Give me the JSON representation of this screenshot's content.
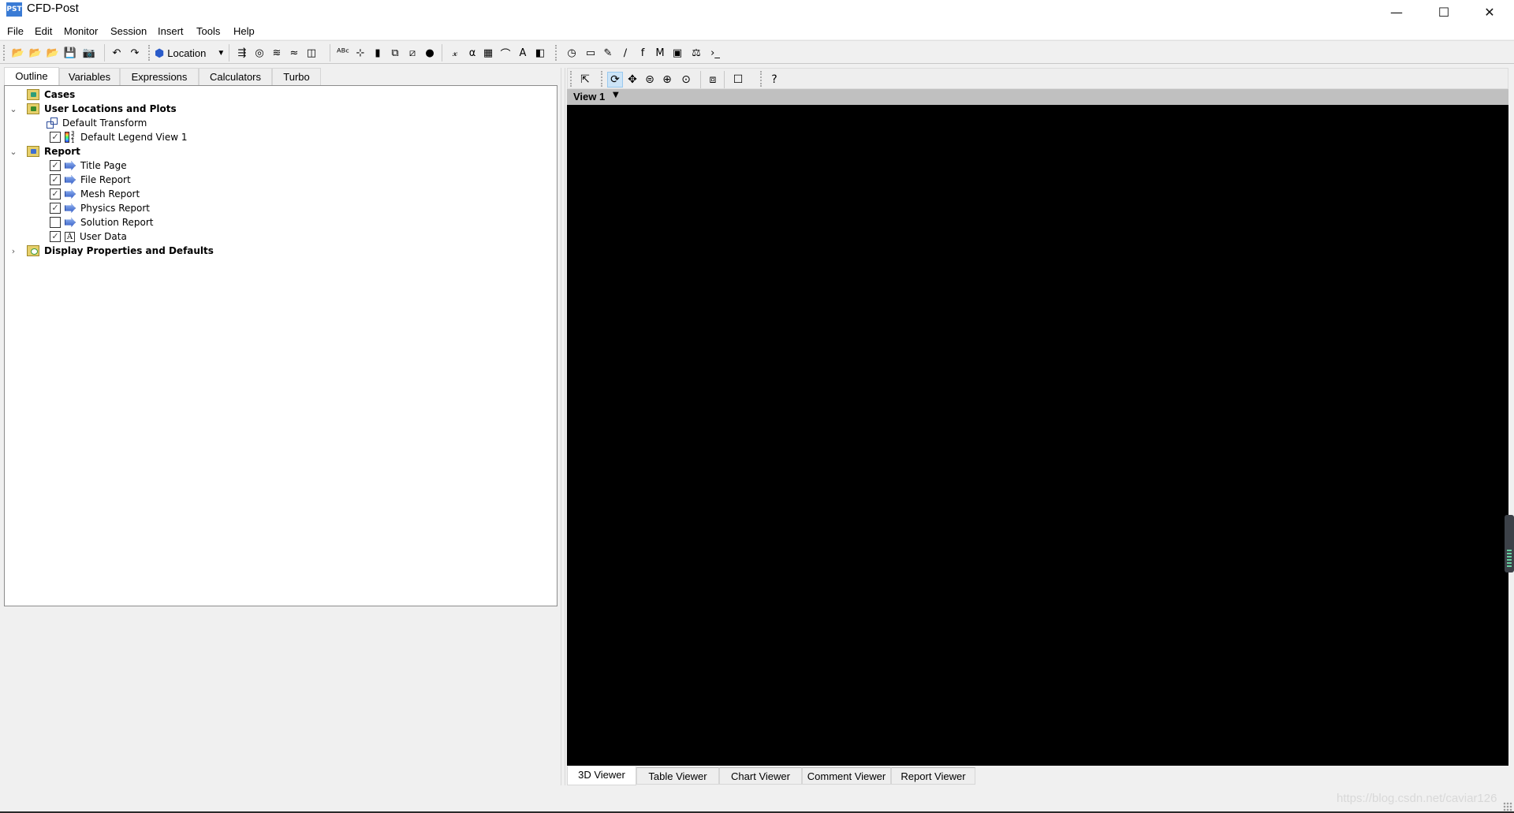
{
  "window": {
    "app_icon_text": "PST",
    "title": "CFD-Post",
    "minimize_glyph": "—",
    "maximize_glyph": "☐",
    "close_glyph": "✕"
  },
  "menubar": {
    "items": [
      "File",
      "Edit",
      "Monitor",
      "Session",
      "Insert",
      "Tools",
      "Help"
    ]
  },
  "toolbar": {
    "location_label": "Location",
    "icons": [
      {
        "name": "load-state-icon",
        "glyph": "📂"
      },
      {
        "name": "load-results-icon",
        "glyph": "📂"
      },
      {
        "name": "close-state-icon",
        "glyph": "📂"
      },
      {
        "name": "save-state-icon",
        "glyph": "💾"
      },
      {
        "name": "save-picture-icon",
        "glyph": "📷"
      },
      {
        "name": "undo-icon",
        "glyph": "↶"
      },
      {
        "name": "redo-icon",
        "glyph": "↷"
      },
      {
        "name": "vector-icon",
        "glyph": "⇶"
      },
      {
        "name": "contour-icon",
        "glyph": "◎"
      },
      {
        "name": "streamline-icon",
        "glyph": "≋"
      },
      {
        "name": "particle-track-icon",
        "glyph": "≈"
      },
      {
        "name": "volume-rendering-icon",
        "glyph": "◫"
      },
      {
        "name": "text-icon",
        "glyph": "ᴬᴮᶜ"
      },
      {
        "name": "coordinate-frame-icon",
        "glyph": "⊹"
      },
      {
        "name": "legend-icon",
        "glyph": "▮"
      },
      {
        "name": "instance-transform-icon",
        "glyph": "⧉"
      },
      {
        "name": "clip-plane-icon",
        "glyph": "⧄"
      },
      {
        "name": "color-map-icon",
        "glyph": "●"
      },
      {
        "name": "variable-icon",
        "glyph": "𝓍"
      },
      {
        "name": "expression-icon",
        "glyph": "α"
      },
      {
        "name": "table-icon",
        "glyph": "▦"
      },
      {
        "name": "chart-icon",
        "glyph": "⌒"
      },
      {
        "name": "comment-icon",
        "glyph": "A"
      },
      {
        "name": "figure-icon",
        "glyph": "◧"
      },
      {
        "name": "animation-clock-icon",
        "glyph": "◷"
      },
      {
        "name": "timestep-film-icon",
        "glyph": "▭"
      },
      {
        "name": "quick-editor-icon",
        "glyph": "✎"
      },
      {
        "name": "probe-icon",
        "glyph": "∕"
      },
      {
        "name": "function-calculator-icon",
        "glyph": "f"
      },
      {
        "name": "macro-calculator-icon",
        "glyph": "M"
      },
      {
        "name": "mesh-calculator-icon",
        "glyph": "▣"
      },
      {
        "name": "case-comparison-icon",
        "glyph": "⚖"
      },
      {
        "name": "command-editor-icon",
        "glyph": "›_"
      }
    ]
  },
  "left_tabs": [
    "Outline",
    "Variables",
    "Expressions",
    "Calculators",
    "Turbo"
  ],
  "tree": {
    "cases": "Cases",
    "user_locations": "User Locations and Plots",
    "default_transform": "Default Transform",
    "default_legend": "Default Legend View 1",
    "report": "Report",
    "report_items": [
      {
        "label": "Title Page",
        "checked": true
      },
      {
        "label": "File Report",
        "checked": true
      },
      {
        "label": "Mesh Report",
        "checked": true
      },
      {
        "label": "Physics Report",
        "checked": true
      },
      {
        "label": "Solution Report",
        "checked": false
      },
      {
        "label": "User Data",
        "checked": true
      }
    ],
    "display_properties": "Display Properties and Defaults",
    "check_glyph": "✓",
    "expanded_glyph": "⌄",
    "collapsed_glyph": "›"
  },
  "viewer": {
    "view_title": "View 1",
    "dropdown_glyph": "▼",
    "toolbar_icons": [
      {
        "name": "select-icon",
        "glyph": "⇱"
      },
      {
        "name": "rotate-icon",
        "glyph": "⟳",
        "active": true
      },
      {
        "name": "pan-icon",
        "glyph": "✥"
      },
      {
        "name": "zoom-icon",
        "glyph": "⊜"
      },
      {
        "name": "zoom-box-icon",
        "glyph": "⊕"
      },
      {
        "name": "zoom-fit-icon",
        "glyph": "⊙"
      },
      {
        "name": "highlight-icon",
        "glyph": "⧈"
      },
      {
        "name": "viewport-layout-icon",
        "glyph": "☐"
      },
      {
        "name": "help-icon",
        "glyph": "?"
      }
    ]
  },
  "bottom_tabs": [
    "3D Viewer",
    "Table Viewer",
    "Chart Viewer",
    "Comment Viewer",
    "Report Viewer"
  ],
  "watermark": "https://blog.csdn.net/caviar126"
}
